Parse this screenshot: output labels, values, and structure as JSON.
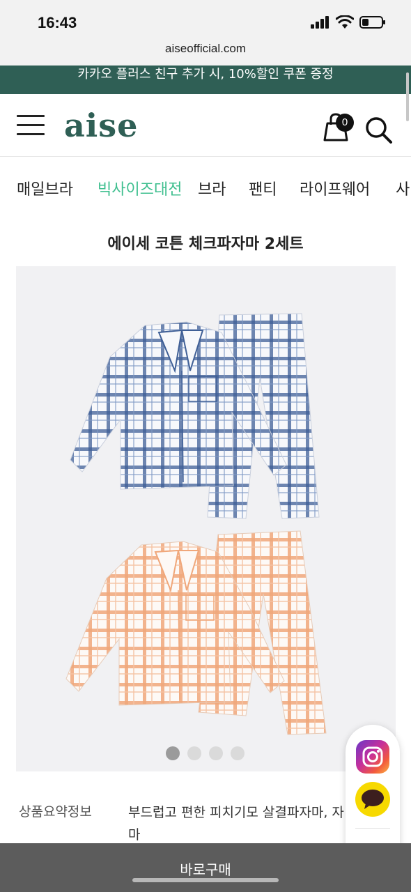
{
  "status_bar": {
    "time": "16:43"
  },
  "browser": {
    "url": "aiseofficial.com"
  },
  "promo": {
    "text": "카카오 플러스 친구 추가 시, 10%할인 쿠폰 증정"
  },
  "header": {
    "logo": "aise",
    "cart_count": "0"
  },
  "categories": [
    {
      "label": "매일브라",
      "active": false
    },
    {
      "label": "빅사이즈대전",
      "active": true
    },
    {
      "label": "브라",
      "active": false
    },
    {
      "label": "팬티",
      "active": false
    },
    {
      "label": "라이프웨어",
      "active": false
    },
    {
      "label": "사",
      "active": false
    }
  ],
  "product": {
    "title": "에이세 코튼 체크파자마 2세트",
    "image_count": 4,
    "current_image": 1,
    "summary_label": "상품요약정보",
    "summary_value": "부드럽고 편한 피치기모 살결파자마, 자마"
  },
  "colors": {
    "brand": "#2f5f55",
    "active_category": "#3fbf8f",
    "buy_bar": "#5c5c5c",
    "blue_check": "#3f5f96",
    "orange_check": "#f0a77a"
  },
  "icons": [
    "hamburger-icon",
    "cart-icon",
    "search-icon",
    "instagram-icon",
    "kakao-talk-icon",
    "chevron-up-icon"
  ],
  "buy_bar": {
    "label": "바로구매"
  }
}
